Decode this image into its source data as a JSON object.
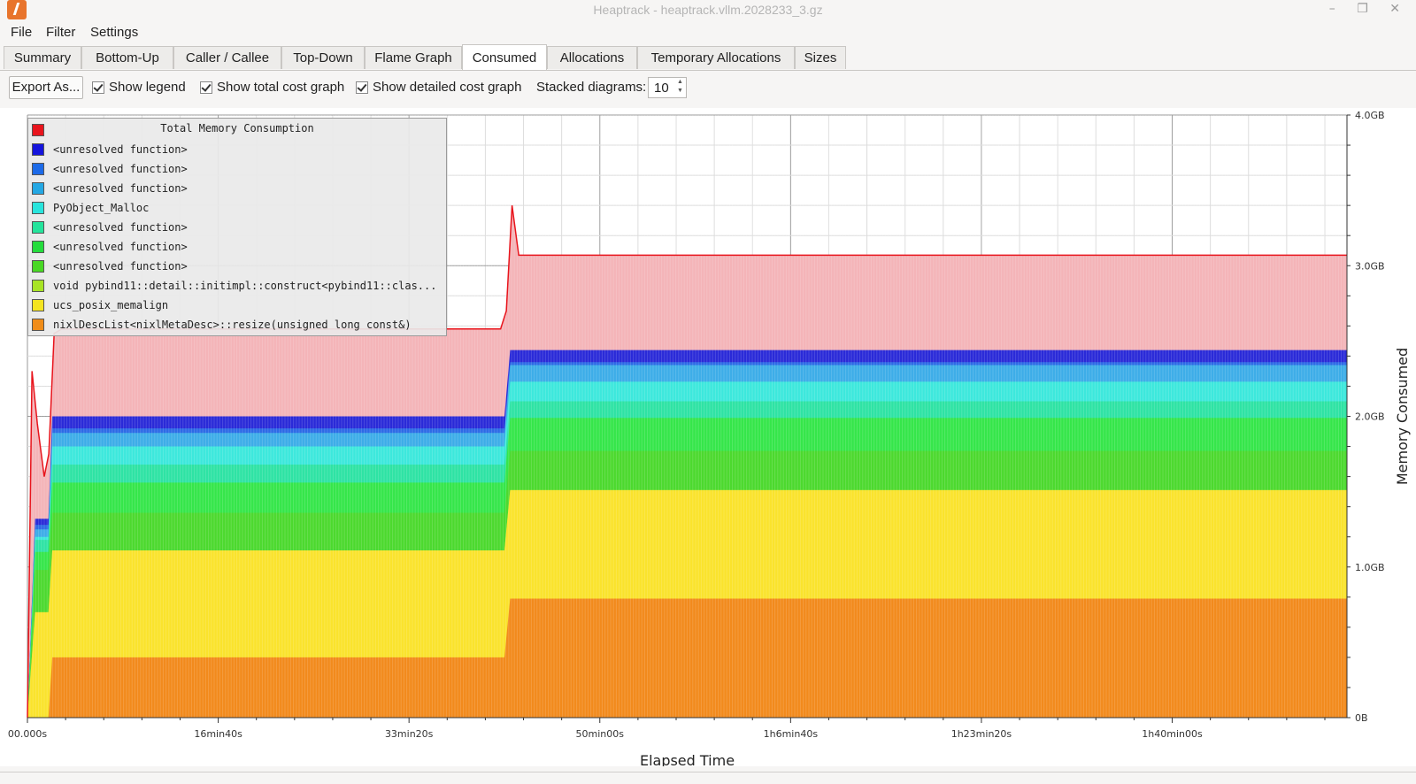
{
  "window": {
    "title": "Heaptrack - heaptrack.vllm.2028233_3.gz",
    "controls": [
      "–",
      "❐",
      "✕"
    ]
  },
  "menu": [
    "File",
    "Filter",
    "Settings"
  ],
  "tabs": [
    {
      "label": "Summary"
    },
    {
      "label": "Bottom-Up"
    },
    {
      "label": "Caller / Callee"
    },
    {
      "label": "Top-Down"
    },
    {
      "label": "Flame Graph"
    },
    {
      "label": "Consumed",
      "active": true
    },
    {
      "label": "Allocations"
    },
    {
      "label": "Temporary Allocations"
    },
    {
      "label": "Sizes"
    }
  ],
  "toolbar": {
    "export_label": "Export As...",
    "show_legend": "Show legend",
    "show_total": "Show total cost graph",
    "show_detailed": "Show detailed cost graph",
    "stacked_label": "Stacked diagrams:",
    "stacked_value": "10"
  },
  "chart_data": {
    "type": "area",
    "stacked": true,
    "xlabel": "Elapsed Time",
    "ylabel": "Memory Consumed",
    "x_ticks": [
      "00.000s",
      "16min40s",
      "33min20s",
      "50min00s",
      "1h6min40s",
      "1h23min20s",
      "1h40min00s"
    ],
    "y_ticks": [
      "0B",
      "1.0GB",
      "2.0GB",
      "3.0GB",
      "4.0GB"
    ],
    "x_range_seconds": [
      0,
      6916
    ],
    "y_range_gb": [
      0,
      4.0
    ],
    "grid": true,
    "legend_position": "top-left",
    "legend_title": "Total Memory Consumption",
    "total": {
      "name": "Total Memory Consumption",
      "color": "#e8141c",
      "fill": "#f4b4b8",
      "points": [
        [
          0,
          0
        ],
        [
          24,
          2.3
        ],
        [
          52,
          1.95
        ],
        [
          88,
          1.6
        ],
        [
          112,
          1.75
        ],
        [
          140,
          2.55
        ],
        [
          180,
          2.58
        ],
        [
          2480,
          2.58
        ],
        [
          2510,
          2.7
        ],
        [
          2540,
          3.4
        ],
        [
          2575,
          3.07
        ],
        [
          2700,
          3.07
        ],
        [
          6916,
          3.07
        ]
      ]
    },
    "layer_times": [
      0,
      40,
      110,
      130,
      2500,
      2530,
      6916
    ],
    "layers": [
      {
        "name": "nixlDescList<nixlMetaDesc>::resize(unsigned long const&)",
        "color": "#f28a1c",
        "levels": [
          0,
          0.0,
          0.0,
          0.4,
          0.4,
          0.79,
          0.79
        ]
      },
      {
        "name": "ucs_posix_memalign",
        "color": "#fae32c",
        "levels": [
          0,
          0.7,
          0.7,
          1.11,
          1.11,
          1.51,
          1.51
        ]
      },
      {
        "name": "void pybind11::detail::initimpl::construct<pybind11::clas...",
        "color": "#a6e526",
        "levels": [
          0,
          0.7,
          0.7,
          1.11,
          1.11,
          1.51,
          1.51
        ]
      },
      {
        "name": "<unresolved function>",
        "color": "#4cd92e",
        "levels": [
          0,
          0.98,
          0.98,
          1.36,
          1.36,
          1.77,
          1.77
        ]
      },
      {
        "name": "<unresolved function>",
        "color": "#35e64a",
        "levels": [
          0,
          1.1,
          1.1,
          1.56,
          1.56,
          1.99,
          1.99
        ]
      },
      {
        "name": "<unresolved function>",
        "color": "#2ee3a4",
        "levels": [
          0,
          1.18,
          1.18,
          1.68,
          1.68,
          2.1,
          2.1
        ]
      },
      {
        "name": "PyObject_Malloc",
        "color": "#3ce8dc",
        "levels": [
          0,
          1.2,
          1.2,
          1.8,
          1.8,
          2.23,
          2.23
        ]
      },
      {
        "name": "<unresolved function>",
        "color": "#3dade8",
        "levels": [
          0,
          1.25,
          1.25,
          1.89,
          1.89,
          2.34,
          2.34
        ]
      },
      {
        "name": "<unresolved function>",
        "color": "#2d6ae6",
        "levels": [
          0,
          1.28,
          1.28,
          1.92,
          1.92,
          2.36,
          2.36
        ]
      },
      {
        "name": "<unresolved function>",
        "color": "#2a2ad8",
        "levels": [
          0,
          1.32,
          1.32,
          2.0,
          2.0,
          2.44,
          2.44
        ]
      }
    ]
  },
  "legend": {
    "title": "Total Memory Consumption",
    "items": [
      {
        "label": "Total Memory Consumption",
        "color": "#e8141c"
      },
      {
        "label": "<unresolved function>",
        "color": "#1414dc"
      },
      {
        "label": "<unresolved function>",
        "color": "#1c6ae8"
      },
      {
        "label": "<unresolved function>",
        "color": "#24a8e4"
      },
      {
        "label": "PyObject_Malloc",
        "color": "#28e4dc"
      },
      {
        "label": "<unresolved function>",
        "color": "#24e49c"
      },
      {
        "label": "<unresolved function>",
        "color": "#24dc3c"
      },
      {
        "label": "<unresolved function>",
        "color": "#48d824"
      },
      {
        "label": "void pybind11::detail::initimpl::construct<pybind11::clas...",
        "color": "#a8e424"
      },
      {
        "label": "ucs_posix_memalign",
        "color": "#f4e420"
      },
      {
        "label": "nixlDescList<nixlMetaDesc>::resize(unsigned long const&)",
        "color": "#f08c18"
      }
    ]
  }
}
